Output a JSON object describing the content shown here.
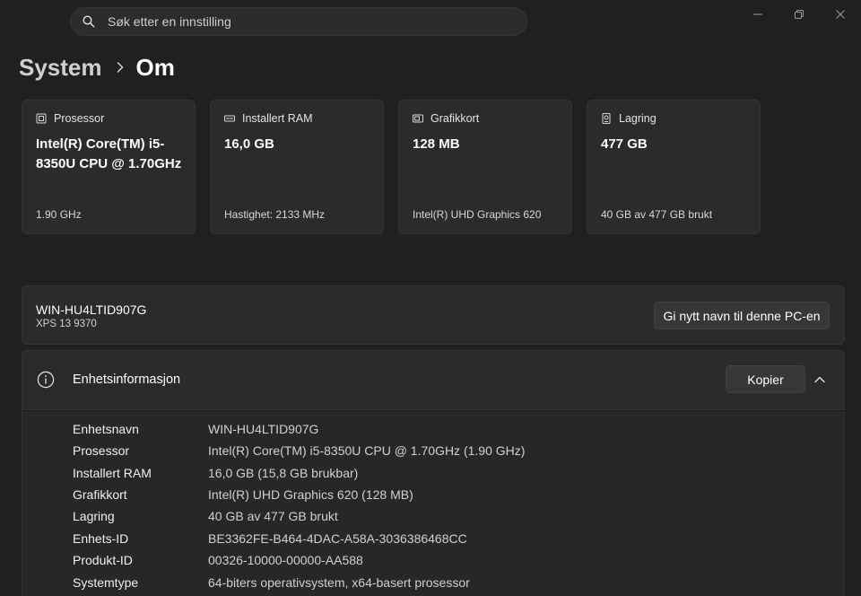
{
  "search": {
    "placeholder": "Søk etter en innstilling"
  },
  "breadcrumb": {
    "parent": "System",
    "current": "Om"
  },
  "cards": [
    {
      "icon": "cpu-icon",
      "label": "Prosessor",
      "value": "Intel(R) Core(TM) i5-8350U CPU @ 1.70GHz",
      "sub": "1.90 GHz"
    },
    {
      "icon": "ram-icon",
      "label": "Installert RAM",
      "value": "16,0 GB",
      "sub": "Hastighet: 2133 MHz"
    },
    {
      "icon": "gpu-icon",
      "label": "Grafikkort",
      "value": "128 MB",
      "sub": "Intel(R) UHD Graphics 620"
    },
    {
      "icon": "storage-icon",
      "label": "Lagring",
      "value": "477 GB",
      "sub": "40 GB av 477 GB brukt"
    }
  ],
  "device": {
    "name": "WIN-HU4LTID907G",
    "model": "XPS 13 9370",
    "rename_label": "Gi nytt navn til denne PC-en"
  },
  "specs": {
    "title": "Enhetsinformasjon",
    "copy_label": "Kopier",
    "rows": [
      {
        "key": "Enhetsnavn",
        "value": "WIN-HU4LTID907G"
      },
      {
        "key": "Prosessor",
        "value": "Intel(R) Core(TM) i5-8350U CPU @ 1.70GHz (1.90 GHz)"
      },
      {
        "key": "Installert RAM",
        "value": "16,0 GB (15,8 GB brukbar)"
      },
      {
        "key": "Grafikkort",
        "value": "Intel(R) UHD Graphics 620 (128 MB)"
      },
      {
        "key": "Lagring",
        "value": "40 GB av 477 GB brukt"
      },
      {
        "key": "Enhets-ID",
        "value": "BE3362FE-B464-4DAC-A58A-3036386468CC"
      },
      {
        "key": "Produkt-ID",
        "value": "00326-10000-00000-AA588"
      },
      {
        "key": "Systemtype",
        "value": "64-biters operativsystem, x64-basert prosessor"
      }
    ]
  }
}
